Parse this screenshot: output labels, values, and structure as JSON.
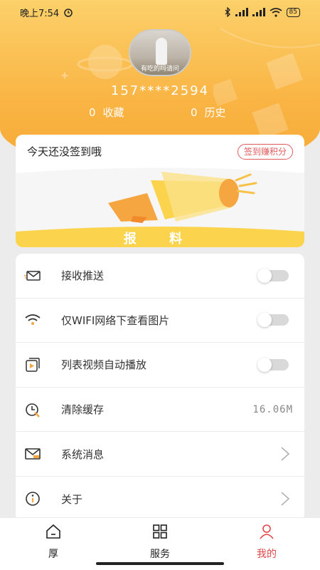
{
  "status_bar": {
    "time": "晚上7:54",
    "battery": "85"
  },
  "profile": {
    "avatar_caption": "有吃的吗请问",
    "phone": "157****2594",
    "favorites_count": "0",
    "favorites_label": "收藏",
    "history_count": "0",
    "history_label": "历史"
  },
  "sign_card": {
    "title": "今天还没签到哦",
    "button": "签到赚积分",
    "banner_text": "报 料"
  },
  "settings": [
    {
      "label": "接收推送",
      "icon": "envelope-send-icon",
      "control": "toggle",
      "on": false
    },
    {
      "label": "仅WIFI网络下查看图片",
      "icon": "wifi-icon",
      "control": "toggle",
      "on": false
    },
    {
      "label": "列表视频自动播放",
      "icon": "video-play-icon",
      "control": "toggle",
      "on": false
    },
    {
      "label": "清除缓存",
      "icon": "clock-clean-icon",
      "control": "value",
      "value": "16.06M"
    },
    {
      "label": "系统消息",
      "icon": "mail-icon",
      "control": "chevron"
    },
    {
      "label": "关于",
      "icon": "info-icon",
      "control": "chevron"
    }
  ],
  "nav": {
    "items": [
      {
        "label": "厚",
        "icon": "home-icon",
        "active": false
      },
      {
        "label": "服务",
        "icon": "grid-icon",
        "active": false
      },
      {
        "label": "我的",
        "icon": "user-icon",
        "active": true
      }
    ]
  },
  "colors": {
    "header_orange": "#f9b443",
    "accent_red": "#e0464a",
    "banner_yellow": "#fbd34d"
  }
}
